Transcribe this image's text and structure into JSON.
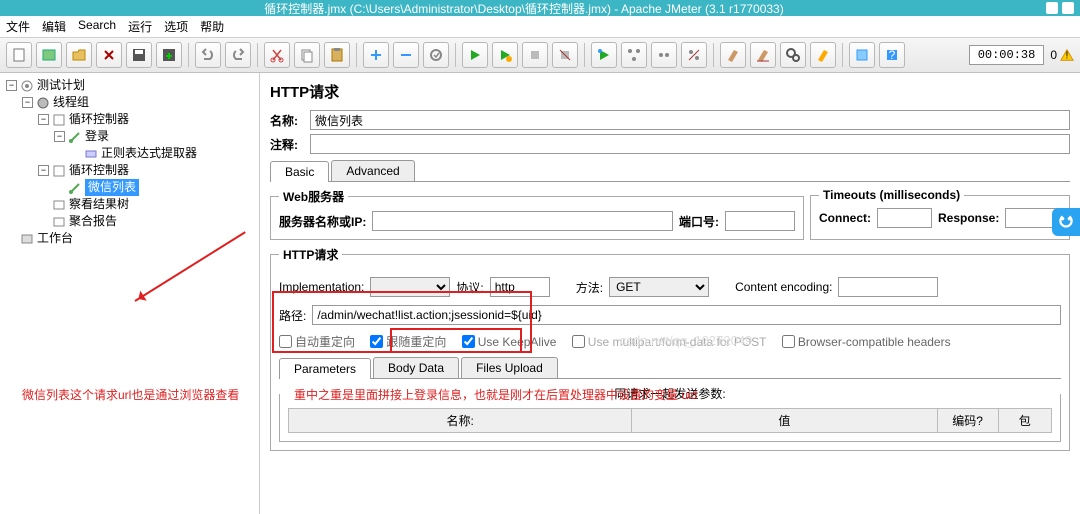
{
  "window": {
    "title_tail": "循环控制器.jmx (C:\\Users\\Administrator\\Desktop\\循环控制器.jmx) - Apache JMeter (3.1 r1770033)"
  },
  "menu": {
    "file": "文件",
    "edit": "编辑",
    "search": "Search",
    "run": "运行",
    "options": "选项",
    "help": "帮助"
  },
  "timer": {
    "value": "00:00:38",
    "warn": "0"
  },
  "tree": {
    "test_plan": "测试计划",
    "thread_group": "线程组",
    "loop1": "循环控制器",
    "login": "登录",
    "regex": "正则表达式提取器",
    "loop2": "循环控制器",
    "wechat": "微信列表",
    "results": "察看结果树",
    "aggregate": "聚合报告",
    "workbench": "工作台"
  },
  "main": {
    "title": "HTTP请求",
    "name_label": "名称:",
    "name_value": "微信列表",
    "comment_label": "注释:",
    "tab_basic": "Basic",
    "tab_advanced": "Advanced",
    "webserver_legend": "Web服务器",
    "server_label": "服务器名称或IP:",
    "port_label": "端口号:",
    "timeouts_legend": "Timeouts (milliseconds)",
    "connect_label": "Connect:",
    "response_label": "Response:",
    "http_legend": "HTTP请求",
    "impl_label": "Implementation:",
    "protocol_label": "协议:",
    "protocol_value": "http",
    "method_label": "方法:",
    "method_value": "GET",
    "encoding_label": "Content encoding:",
    "path_label": "路径:",
    "path_value": "/admin/wechat!list.action;jsessionid=${uid}",
    "chk_auto": "自动重定向",
    "chk_follow": "跟随重定向",
    "chk_keepalive": "Use KeepAlive",
    "chk_multipart": "Use multipart/form-data for POST",
    "chk_browser": "Browser-compatible headers",
    "param_tab_params": "Parameters",
    "param_tab_body": "Body Data",
    "param_tab_files": "Files Upload",
    "params_legend": "同请求一起发送参数:",
    "col_name": "名称:",
    "col_value": "值",
    "col_encode": "编码?",
    "col_include": "包"
  },
  "annot": {
    "line1": "微信列表这个请求url也是通过浏览器查看",
    "line2": "重中之重是里面拼接上登录信息，也就是刚才在后置处理器中设置的变量 uid"
  },
  "watermark": "csdn.net/qq_10272049"
}
